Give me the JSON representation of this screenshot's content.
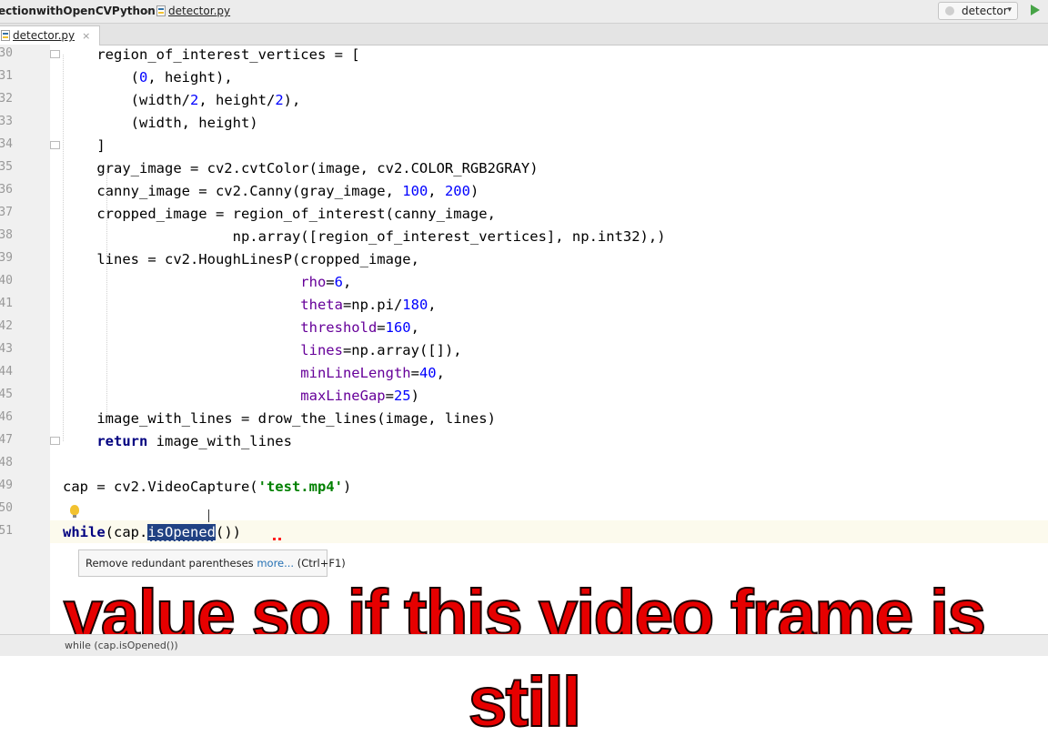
{
  "navbar": {
    "project": "ectionwithOpenCVPython",
    "separator": "›",
    "file": "detector.py",
    "run_config": "detector",
    "run_config_arrow": "▾"
  },
  "tabs": [
    {
      "label": "detector.py",
      "close": "×"
    }
  ],
  "gutter": {
    "line_numbers": [
      "30",
      "31",
      "32",
      "33",
      "34",
      "35",
      "36",
      "37",
      "38",
      "39",
      "40",
      "41",
      "42",
      "43",
      "44",
      "45",
      "46",
      "47",
      "48",
      "49",
      "50",
      "51"
    ]
  },
  "code_lines": [
    [
      {
        "t": "    region_of_interest_vertices = ["
      }
    ],
    [
      {
        "t": "        ("
      },
      {
        "t": "0",
        "c": "num"
      },
      {
        "t": ", height),"
      }
    ],
    [
      {
        "t": "        (width/"
      },
      {
        "t": "2",
        "c": "num"
      },
      {
        "t": ", height/"
      },
      {
        "t": "2",
        "c": "num"
      },
      {
        "t": "),"
      }
    ],
    [
      {
        "t": "        (width, height)"
      }
    ],
    [
      {
        "t": "    ]"
      }
    ],
    [
      {
        "t": "    gray_image = cv2.cvtColor(image, cv2.COLOR_RGB2GRAY)"
      }
    ],
    [
      {
        "t": "    canny_image = cv2.Canny(gray_image, "
      },
      {
        "t": "100",
        "c": "num"
      },
      {
        "t": ", "
      },
      {
        "t": "200",
        "c": "num"
      },
      {
        "t": ")"
      }
    ],
    [
      {
        "t": "    cropped_image = region_of_interest(canny_image,"
      }
    ],
    [
      {
        "t": "                    np.array([region_of_interest_vertices], np.int32),)"
      }
    ],
    [
      {
        "t": "    lines = cv2.HoughLinesP(cropped_image,"
      }
    ],
    [
      {
        "t": "                            "
      },
      {
        "t": "rho",
        "c": "param"
      },
      {
        "t": "="
      },
      {
        "t": "6",
        "c": "num"
      },
      {
        "t": ","
      }
    ],
    [
      {
        "t": "                            "
      },
      {
        "t": "theta",
        "c": "param"
      },
      {
        "t": "=np.pi/"
      },
      {
        "t": "180",
        "c": "num"
      },
      {
        "t": ","
      }
    ],
    [
      {
        "t": "                            "
      },
      {
        "t": "threshold",
        "c": "param"
      },
      {
        "t": "="
      },
      {
        "t": "160",
        "c": "num"
      },
      {
        "t": ","
      }
    ],
    [
      {
        "t": "                            "
      },
      {
        "t": "lines",
        "c": "param"
      },
      {
        "t": "=np.array([]),"
      }
    ],
    [
      {
        "t": "                            "
      },
      {
        "t": "minLineLength",
        "c": "param"
      },
      {
        "t": "="
      },
      {
        "t": "40",
        "c": "num"
      },
      {
        "t": ","
      }
    ],
    [
      {
        "t": "                            "
      },
      {
        "t": "maxLineGap",
        "c": "param"
      },
      {
        "t": "="
      },
      {
        "t": "25",
        "c": "num"
      },
      {
        "t": ")"
      }
    ],
    [
      {
        "t": "    image_with_lines = drow_the_lines(image, lines)"
      }
    ],
    [
      {
        "t": "    "
      },
      {
        "t": "return",
        "c": "kw"
      },
      {
        "t": " image_with_lines"
      }
    ],
    [
      {
        "t": ""
      }
    ],
    [
      {
        "t": "cap = cv2.VideoCapture("
      },
      {
        "t": "'test.mp4'",
        "c": "str"
      },
      {
        "t": ")"
      }
    ],
    [
      {
        "t": ""
      }
    ],
    [
      {
        "t": "while",
        "c": "kw"
      },
      {
        "t": "(cap."
      },
      {
        "t": "isOpened",
        "c": "sel"
      },
      {
        "t": "())"
      }
    ]
  ],
  "tooltip": {
    "text": "Remove redundant parentheses ",
    "more": "more...",
    "shortcut": " (Ctrl+F1)"
  },
  "subtitle": "value so if this video frame is still",
  "statusbar": {
    "context": "while (cap.isOpened())"
  },
  "colors": {
    "number": "#0000ff",
    "keyword": "#000080",
    "param": "#660099",
    "string": "#008000",
    "subtitle": "#e60000",
    "selection": "#214283"
  }
}
